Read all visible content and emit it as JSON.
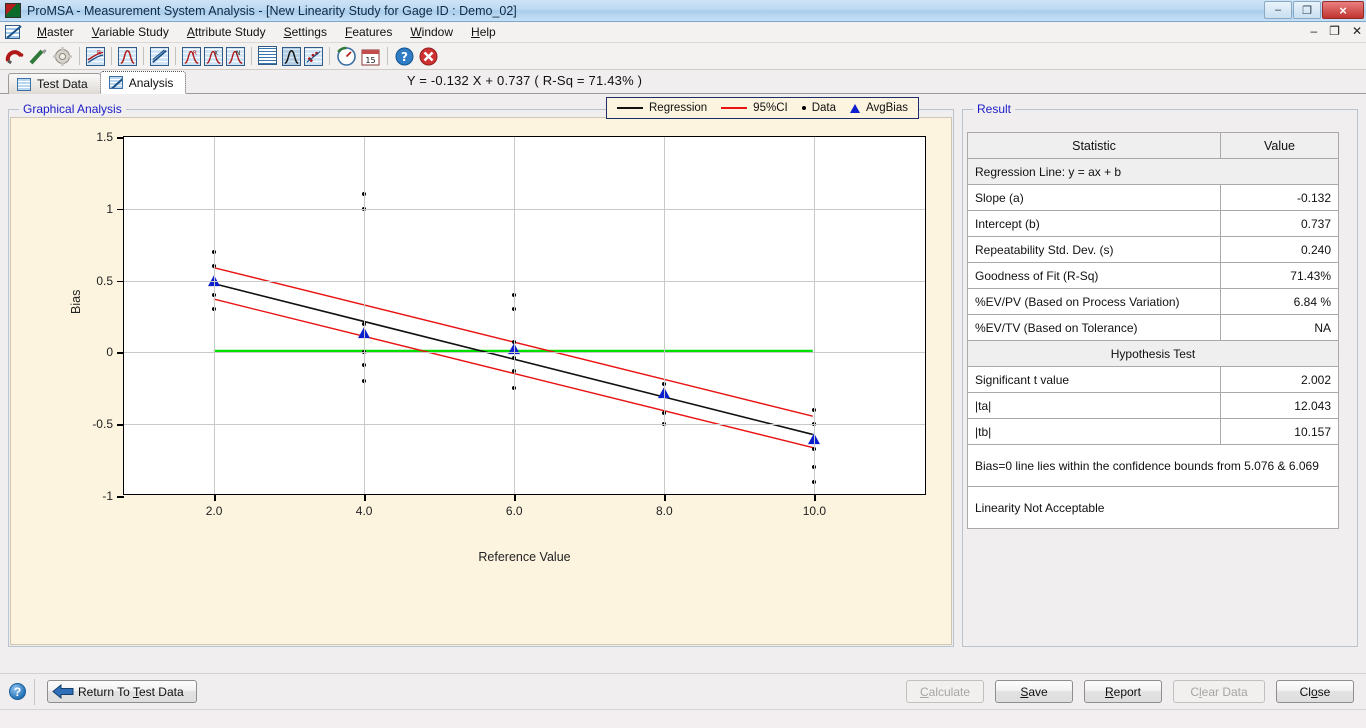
{
  "window": {
    "title": "ProMSA - Measurement System Analysis  - [New Linearity Study for Gage ID :  Demo_02]",
    "minimize": "–",
    "restore": "❐",
    "close": "×",
    "mdi_minimize": "–",
    "mdi_restore": "❐",
    "mdi_close": "✕"
  },
  "menu": {
    "items": [
      {
        "label": "Master",
        "accel": "M"
      },
      {
        "label": "Variable Study",
        "accel": "V"
      },
      {
        "label": "Attribute Study",
        "accel": "A"
      },
      {
        "label": "Settings",
        "accel": "S"
      },
      {
        "label": "Features",
        "accel": "F"
      },
      {
        "label": "Window",
        "accel": "W"
      },
      {
        "label": "Help",
        "accel": "H"
      }
    ]
  },
  "toolbar": {
    "icons": [
      "magnet-icon",
      "pencil-icon",
      "gear-icon",
      "regression-chart-icon",
      "distribution-chart-icon",
      "linearity-chart-icon",
      "range-chart-r-icon",
      "xbar-chart-icon",
      "np-chart-icon",
      "data-grid-icon",
      "anova-chart-icon",
      "scatter-chart-icon",
      "gauge-icon",
      "calendar-icon",
      "help-icon",
      "exit-icon"
    ]
  },
  "tabs": [
    {
      "label": "Test Data",
      "icon": "table-icon",
      "active": false
    },
    {
      "label": "Analysis",
      "icon": "chart-icon",
      "active": true
    }
  ],
  "graph_panel": {
    "legend": "Graphical Analysis"
  },
  "result_panel": {
    "legend": "Result",
    "headers": [
      "Statistic",
      "Value"
    ],
    "rows": [
      {
        "type": "section",
        "label": "Regression Line: y = ax + b"
      },
      {
        "type": "data",
        "label": "Slope (a)",
        "value": "-0.132"
      },
      {
        "type": "data",
        "label": "Intercept (b)",
        "value": "0.737"
      },
      {
        "type": "data",
        "label": "Repeatability Std. Dev. (s)",
        "value": "0.240"
      },
      {
        "type": "data",
        "label": "Goodness of Fit (R-Sq)",
        "value": "71.43%"
      },
      {
        "type": "data",
        "label": "%EV/PV (Based  on Process Variation)",
        "value": "6.84 %"
      },
      {
        "type": "data",
        "label": "%EV/TV (Based on Tolerance)",
        "value": "NA"
      },
      {
        "type": "section-center",
        "label": "Hypothesis Test"
      },
      {
        "type": "data",
        "label": "Significant t value",
        "value": "2.002"
      },
      {
        "type": "data",
        "label": "|ta|",
        "value": "12.043"
      },
      {
        "type": "data",
        "label": "|tb|",
        "value": "10.157"
      },
      {
        "type": "wide",
        "label": "Bias=0 line lies within the confidence bounds from 5.076  & 6.069"
      },
      {
        "type": "wide",
        "label": "Linearity Not Acceptable"
      }
    ]
  },
  "footer": {
    "help_glyph": "?",
    "return_label": "Return To Test Data",
    "return_accel": "T",
    "buttons": [
      {
        "label": "Calculate",
        "accel": "C",
        "disabled": true
      },
      {
        "label": "Save",
        "accel": "S",
        "disabled": false
      },
      {
        "label": "Report",
        "accel": "R",
        "disabled": false
      },
      {
        "label": "Clear Data",
        "accel": "l",
        "disabled": true
      },
      {
        "label": "Close",
        "accel": "o",
        "disabled": false
      }
    ]
  },
  "chart_data": {
    "type": "scatter",
    "title": "Y = -0.132 X + 0.737   ( R-Sq = 71.43% )",
    "xlabel": "Reference Value",
    "ylabel": "Bias",
    "xlim": [
      0.8,
      11.5
    ],
    "ylim": [
      -1,
      1.5
    ],
    "xticks": [
      2.0,
      4.0,
      6.0,
      8.0,
      10.0
    ],
    "xticklabels": [
      "2.0",
      "4.0",
      "6.0",
      "8.0",
      "10.0"
    ],
    "yticks": [
      1.5,
      1,
      0.5,
      0,
      -0.5,
      -1
    ],
    "yticklabels": [
      "1.5",
      "1",
      "0.5",
      "0",
      "-0.5",
      "-1"
    ],
    "grid": true,
    "legend_position": "top-right",
    "legend": [
      {
        "label": "Regression",
        "marker": "line",
        "color": "#111111"
      },
      {
        "label": "95%CI",
        "marker": "line",
        "color": "#e81414"
      },
      {
        "label": "Data",
        "marker": "dot",
        "color": "#000000"
      },
      {
        "label": "AvgBias",
        "marker": "triangle",
        "color": "#0b1fcf"
      }
    ],
    "regression": {
      "slope": -0.132,
      "intercept": 0.737,
      "color": "#111111"
    },
    "ci_upper": {
      "x": [
        2,
        10
      ],
      "y": [
        0.585,
        -0.455
      ],
      "color": "#e81414"
    },
    "ci_lower": {
      "x": [
        2,
        10
      ],
      "y": [
        0.365,
        -0.675
      ],
      "color": "#e81414"
    },
    "zero_line": {
      "y": 0,
      "x": [
        2,
        10
      ],
      "color": "#00e000"
    },
    "avg_bias": {
      "x": [
        2,
        4,
        6,
        8,
        10
      ],
      "y": [
        0.48,
        0.12,
        0.01,
        -0.3,
        -0.62
      ],
      "color": "#0b1fcf"
    },
    "data_points": [
      {
        "x": 2,
        "y": 0.7
      },
      {
        "x": 2,
        "y": 0.6
      },
      {
        "x": 2,
        "y": 0.4
      },
      {
        "x": 2,
        "y": 0.3
      },
      {
        "x": 4,
        "y": 1.1
      },
      {
        "x": 4,
        "y": 1.0
      },
      {
        "x": 4,
        "y": 0.2
      },
      {
        "x": 4,
        "y": 0.0
      },
      {
        "x": 4,
        "y": -0.09
      },
      {
        "x": 4,
        "y": -0.2
      },
      {
        "x": 6,
        "y": 0.4
      },
      {
        "x": 6,
        "y": 0.3
      },
      {
        "x": 6,
        "y": 0.07
      },
      {
        "x": 6,
        "y": -0.04
      },
      {
        "x": 6,
        "y": -0.13
      },
      {
        "x": 6,
        "y": -0.25
      },
      {
        "x": 8,
        "y": -0.22
      },
      {
        "x": 8,
        "y": -0.42
      },
      {
        "x": 8,
        "y": -0.5
      },
      {
        "x": 10,
        "y": -0.4
      },
      {
        "x": 10,
        "y": -0.5
      },
      {
        "x": 10,
        "y": -0.67
      },
      {
        "x": 10,
        "y": -0.8
      },
      {
        "x": 10,
        "y": -0.9
      }
    ]
  }
}
